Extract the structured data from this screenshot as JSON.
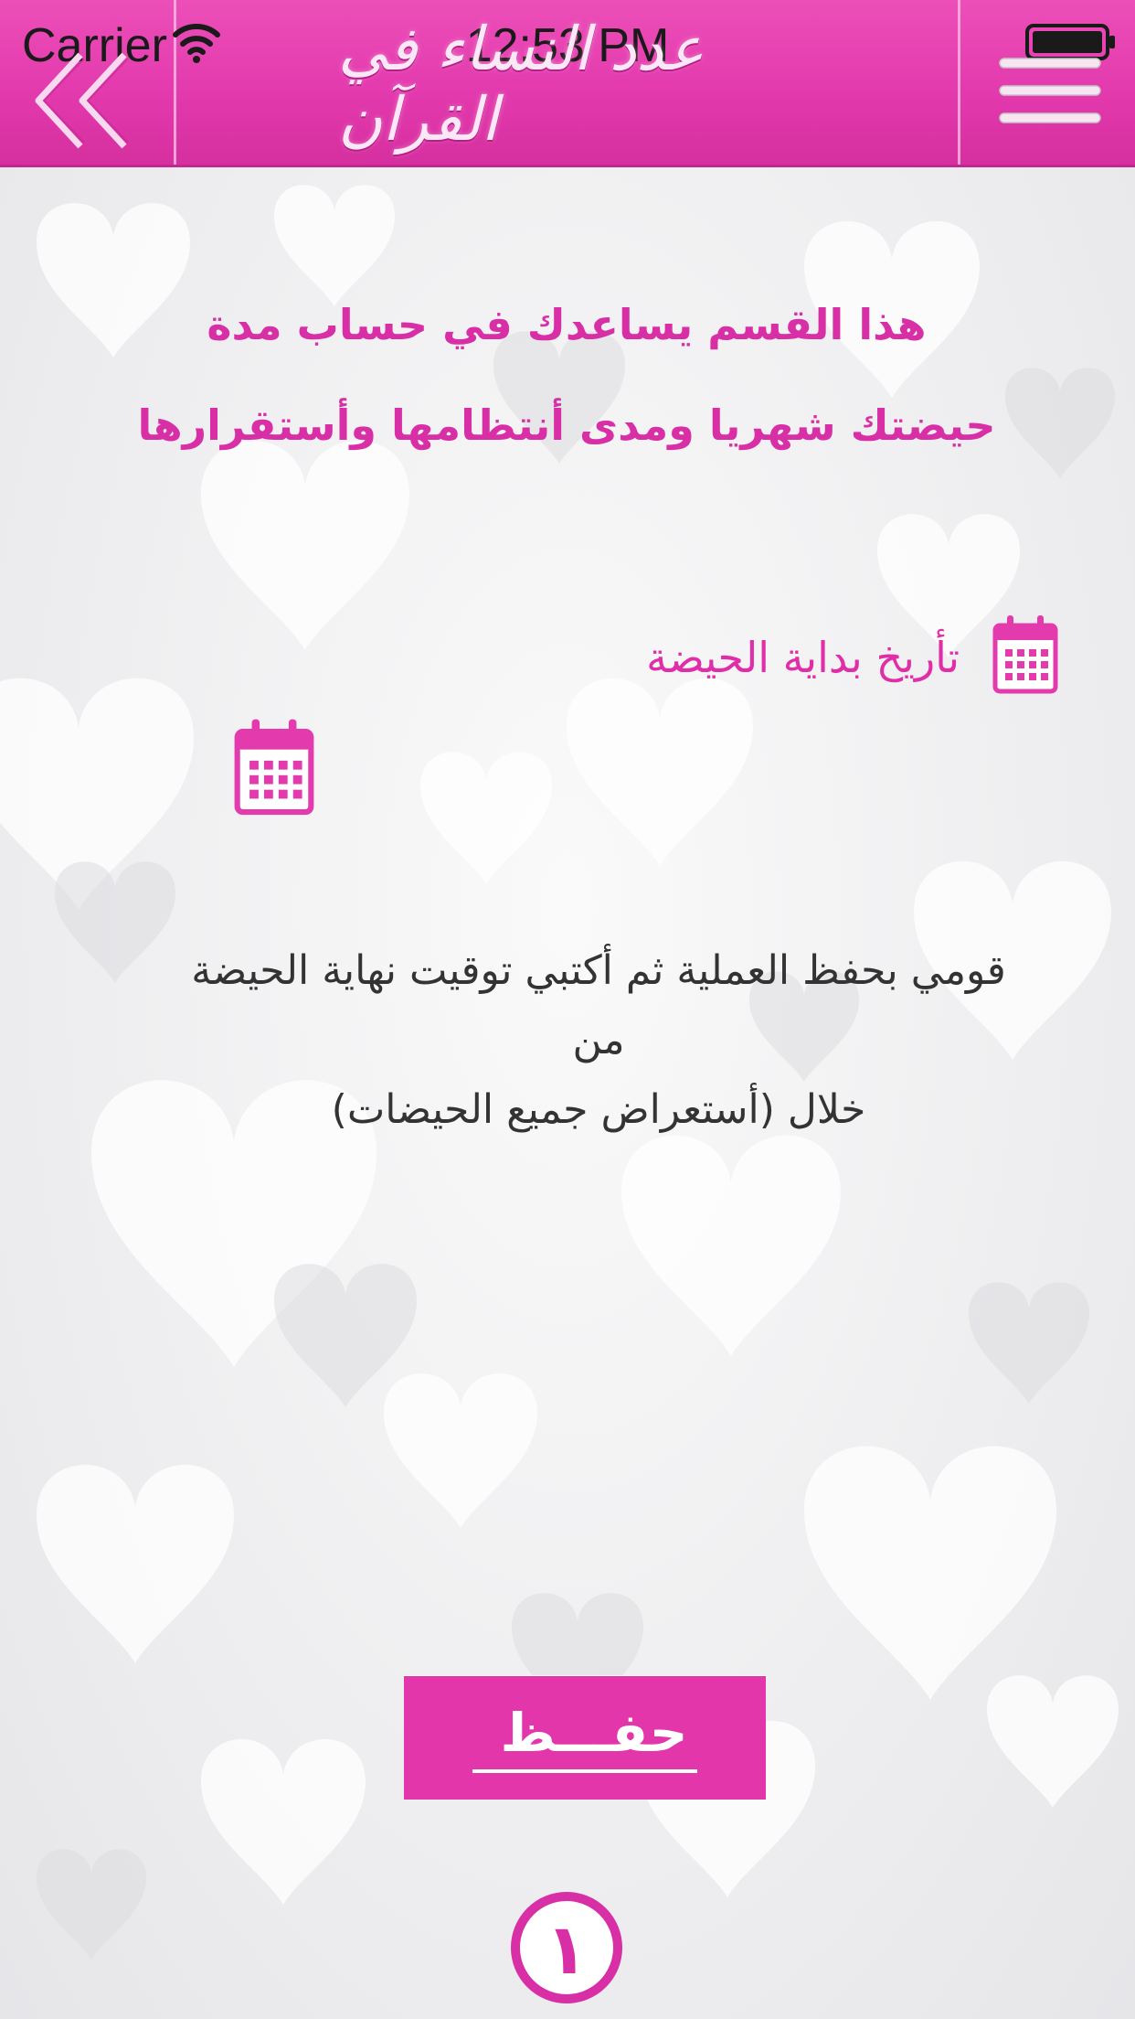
{
  "status_bar": {
    "carrier": "Carrier",
    "time": "12:53 PM"
  },
  "header": {
    "logo_text": "عدد النساء في القرآن"
  },
  "intro": {
    "line1": "هذا القسم يساعدك في حساب مدة",
    "line2": "حيضتك شهريا ومدى أنتظامها وأستقرارها"
  },
  "start_date": {
    "label": "تأريخ  بداية الحيضة"
  },
  "instructions": {
    "line1": "قومي بحفظ العملية ثم أكتبي توقيت نهاية الحيضة من",
    "line2": "خلال  (أستعراض جميع الحيضات)"
  },
  "save": {
    "label": "حفـــظ"
  },
  "help_badge": {
    "label": "١"
  },
  "colors": {
    "brand_pink": "#e236aa",
    "text_pink": "#d82fa6",
    "body_text": "#333333"
  },
  "icons": [
    "back-chevrons-icon",
    "menu-icon",
    "wifi-icon",
    "battery-icon",
    "calendar-icon"
  ]
}
